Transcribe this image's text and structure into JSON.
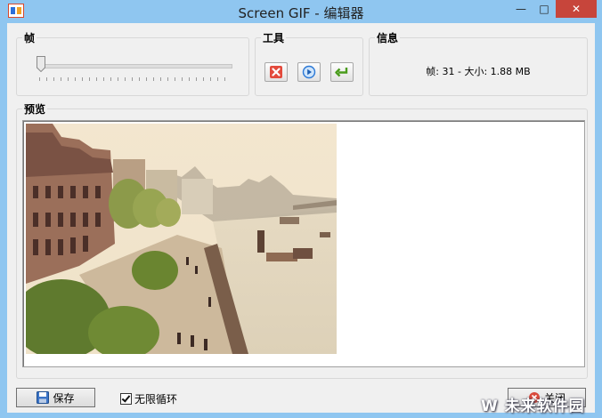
{
  "window": {
    "title": "Screen GIF - 编辑器",
    "controls": {
      "minimize": "—",
      "maximize": "□",
      "close": "✕"
    }
  },
  "frame_group": {
    "label": "帧",
    "slider_position": 0.0
  },
  "tools_group": {
    "label": "工具",
    "buttons": [
      {
        "name": "delete",
        "icon": "red-x-icon"
      },
      {
        "name": "play",
        "icon": "play-circle-icon"
      },
      {
        "name": "loop",
        "icon": "green-return-arrow-icon"
      }
    ]
  },
  "info_group": {
    "label": "信息",
    "text": "帧: 31 - 大小: 1.88 MB"
  },
  "preview_group": {
    "label": "预览"
  },
  "footer": {
    "save_label": "保存",
    "loop_label": "无限循环",
    "loop_checked": true,
    "close_label": "关闭"
  },
  "watermark": "W 未来软件园",
  "colors": {
    "titlebar": "#8fc6f0",
    "close": "#c7453b",
    "panel": "#f0f0f0"
  }
}
